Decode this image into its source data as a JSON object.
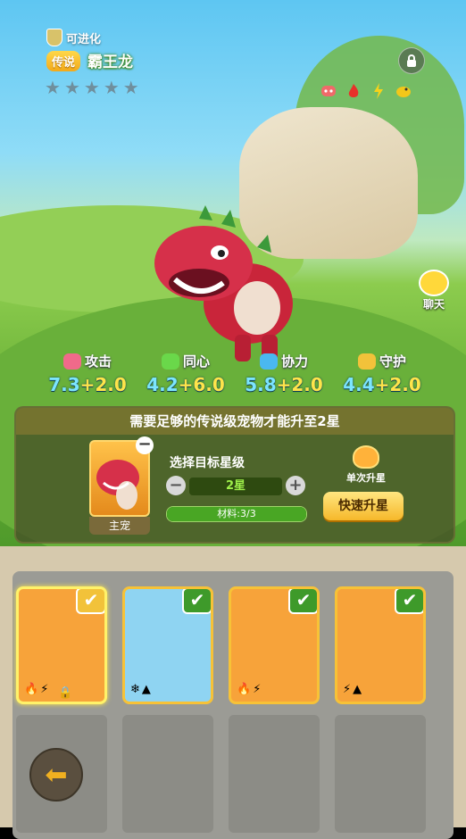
{
  "header": {
    "evolve_label": "可进化",
    "rarity_label": "传说",
    "pet_name": "霸王龙",
    "star_count": 5,
    "lit_stars": 0,
    "element_icons": [
      "pig-face-icon",
      "fire-icon",
      "lightning-icon",
      "duck-icon"
    ]
  },
  "side": {
    "chat_label": "聊天"
  },
  "stats": [
    {
      "icon": "attack-icon",
      "label": "攻击",
      "base": "7.3",
      "bonus": "+2.0",
      "color": "#f06a8a"
    },
    {
      "icon": "empathy-icon",
      "label": "同心",
      "base": "4.2",
      "bonus": "+6.0",
      "color": "#6ad84a"
    },
    {
      "icon": "cooperate-icon",
      "label": "协力",
      "base": "5.8",
      "bonus": "+2.0",
      "color": "#4ab8f0"
    },
    {
      "icon": "guard-icon",
      "label": "守护",
      "base": "4.4",
      "bonus": "+2.0",
      "color": "#f2c23a"
    }
  ],
  "upgrade_panel": {
    "message": "需要足够的传说级宠物才能升至2星",
    "main_pet_tag": "主宠",
    "choose_label": "选择目标星级",
    "target_star": "2星",
    "minus": "−",
    "plus": "+",
    "material_text": "材料:3/3",
    "material_progress": 1.0,
    "single_label": "单次升星",
    "quick_label": "快速升星",
    "remove": "−"
  },
  "pets": [
    {
      "name": "tyrannosaurus-card",
      "bg": "#f7a33a",
      "selected": true,
      "locked": true,
      "elements": [
        "🔥",
        "⚡"
      ]
    },
    {
      "name": "rabbit-seal-card",
      "bg": "#8fd4f2",
      "selected": false,
      "locked": false,
      "elements": [
        "❄",
        "▲"
      ]
    },
    {
      "name": "black-dragon-card",
      "bg": "#f7a33a",
      "selected": false,
      "locked": false,
      "elements": [
        "🔥",
        "⚡"
      ]
    },
    {
      "name": "bear-card",
      "bg": "#f7a33a",
      "selected": false,
      "locked": false,
      "elements": [
        "⚡",
        "▲"
      ]
    }
  ],
  "check_mark": "✔",
  "nav": {
    "back_arrow": "⬅"
  }
}
